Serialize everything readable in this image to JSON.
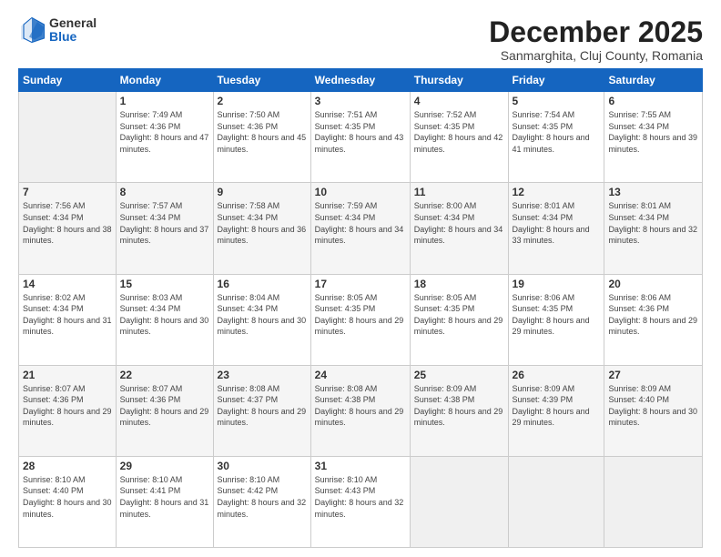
{
  "logo": {
    "general": "General",
    "blue": "Blue"
  },
  "header": {
    "month": "December 2025",
    "location": "Sanmarghita, Cluj County, Romania"
  },
  "weekdays": [
    "Sunday",
    "Monday",
    "Tuesday",
    "Wednesday",
    "Thursday",
    "Friday",
    "Saturday"
  ],
  "weeks": [
    [
      {
        "num": "",
        "empty": true
      },
      {
        "num": "1",
        "sunrise": "7:49 AM",
        "sunset": "4:36 PM",
        "daylight": "8 hours and 47 minutes."
      },
      {
        "num": "2",
        "sunrise": "7:50 AM",
        "sunset": "4:36 PM",
        "daylight": "8 hours and 45 minutes."
      },
      {
        "num": "3",
        "sunrise": "7:51 AM",
        "sunset": "4:35 PM",
        "daylight": "8 hours and 43 minutes."
      },
      {
        "num": "4",
        "sunrise": "7:52 AM",
        "sunset": "4:35 PM",
        "daylight": "8 hours and 42 minutes."
      },
      {
        "num": "5",
        "sunrise": "7:54 AM",
        "sunset": "4:35 PM",
        "daylight": "8 hours and 41 minutes."
      },
      {
        "num": "6",
        "sunrise": "7:55 AM",
        "sunset": "4:34 PM",
        "daylight": "8 hours and 39 minutes."
      }
    ],
    [
      {
        "num": "7",
        "sunrise": "7:56 AM",
        "sunset": "4:34 PM",
        "daylight": "8 hours and 38 minutes."
      },
      {
        "num": "8",
        "sunrise": "7:57 AM",
        "sunset": "4:34 PM",
        "daylight": "8 hours and 37 minutes."
      },
      {
        "num": "9",
        "sunrise": "7:58 AM",
        "sunset": "4:34 PM",
        "daylight": "8 hours and 36 minutes."
      },
      {
        "num": "10",
        "sunrise": "7:59 AM",
        "sunset": "4:34 PM",
        "daylight": "8 hours and 34 minutes."
      },
      {
        "num": "11",
        "sunrise": "8:00 AM",
        "sunset": "4:34 PM",
        "daylight": "8 hours and 34 minutes."
      },
      {
        "num": "12",
        "sunrise": "8:01 AM",
        "sunset": "4:34 PM",
        "daylight": "8 hours and 33 minutes."
      },
      {
        "num": "13",
        "sunrise": "8:01 AM",
        "sunset": "4:34 PM",
        "daylight": "8 hours and 32 minutes."
      }
    ],
    [
      {
        "num": "14",
        "sunrise": "8:02 AM",
        "sunset": "4:34 PM",
        "daylight": "8 hours and 31 minutes."
      },
      {
        "num": "15",
        "sunrise": "8:03 AM",
        "sunset": "4:34 PM",
        "daylight": "8 hours and 30 minutes."
      },
      {
        "num": "16",
        "sunrise": "8:04 AM",
        "sunset": "4:34 PM",
        "daylight": "8 hours and 30 minutes."
      },
      {
        "num": "17",
        "sunrise": "8:05 AM",
        "sunset": "4:35 PM",
        "daylight": "8 hours and 29 minutes."
      },
      {
        "num": "18",
        "sunrise": "8:05 AM",
        "sunset": "4:35 PM",
        "daylight": "8 hours and 29 minutes."
      },
      {
        "num": "19",
        "sunrise": "8:06 AM",
        "sunset": "4:35 PM",
        "daylight": "8 hours and 29 minutes."
      },
      {
        "num": "20",
        "sunrise": "8:06 AM",
        "sunset": "4:36 PM",
        "daylight": "8 hours and 29 minutes."
      }
    ],
    [
      {
        "num": "21",
        "sunrise": "8:07 AM",
        "sunset": "4:36 PM",
        "daylight": "8 hours and 29 minutes."
      },
      {
        "num": "22",
        "sunrise": "8:07 AM",
        "sunset": "4:36 PM",
        "daylight": "8 hours and 29 minutes."
      },
      {
        "num": "23",
        "sunrise": "8:08 AM",
        "sunset": "4:37 PM",
        "daylight": "8 hours and 29 minutes."
      },
      {
        "num": "24",
        "sunrise": "8:08 AM",
        "sunset": "4:38 PM",
        "daylight": "8 hours and 29 minutes."
      },
      {
        "num": "25",
        "sunrise": "8:09 AM",
        "sunset": "4:38 PM",
        "daylight": "8 hours and 29 minutes."
      },
      {
        "num": "26",
        "sunrise": "8:09 AM",
        "sunset": "4:39 PM",
        "daylight": "8 hours and 29 minutes."
      },
      {
        "num": "27",
        "sunrise": "8:09 AM",
        "sunset": "4:40 PM",
        "daylight": "8 hours and 30 minutes."
      }
    ],
    [
      {
        "num": "28",
        "sunrise": "8:10 AM",
        "sunset": "4:40 PM",
        "daylight": "8 hours and 30 minutes."
      },
      {
        "num": "29",
        "sunrise": "8:10 AM",
        "sunset": "4:41 PM",
        "daylight": "8 hours and 31 minutes."
      },
      {
        "num": "30",
        "sunrise": "8:10 AM",
        "sunset": "4:42 PM",
        "daylight": "8 hours and 32 minutes."
      },
      {
        "num": "31",
        "sunrise": "8:10 AM",
        "sunset": "4:43 PM",
        "daylight": "8 hours and 32 minutes."
      },
      {
        "num": "",
        "empty": true
      },
      {
        "num": "",
        "empty": true
      },
      {
        "num": "",
        "empty": true
      }
    ]
  ]
}
